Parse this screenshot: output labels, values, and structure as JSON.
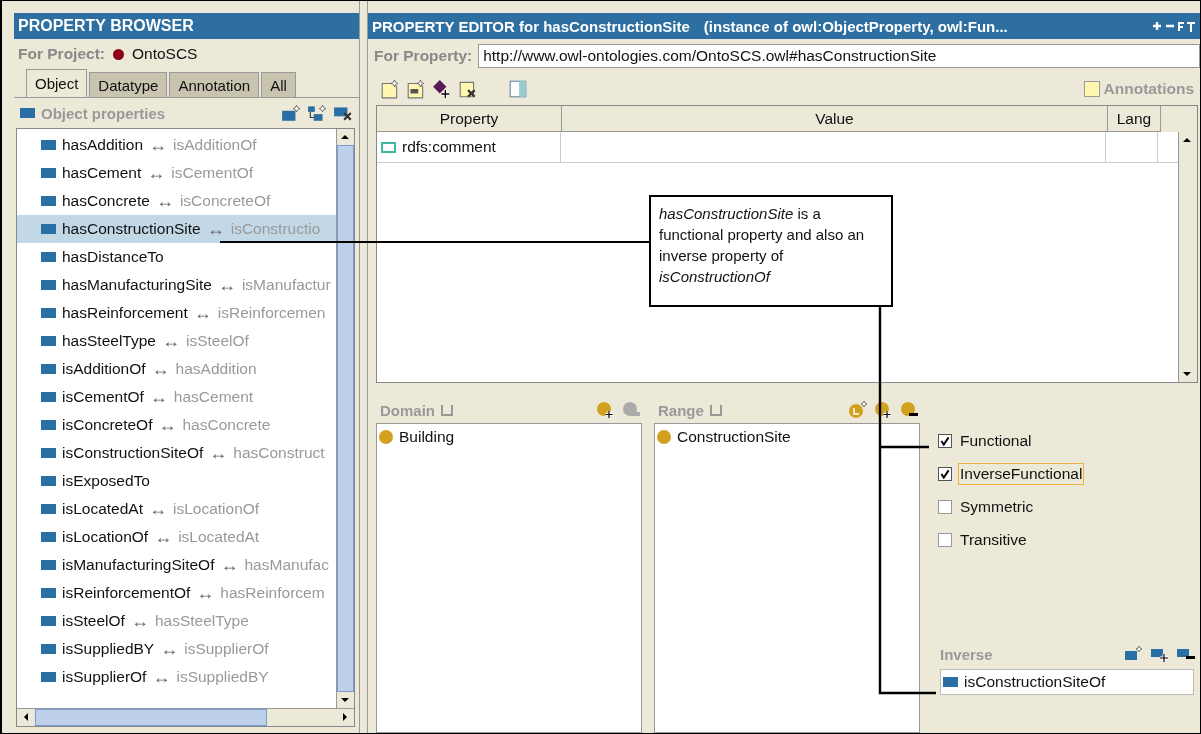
{
  "browser": {
    "title": "PROPERTY BROWSER",
    "project_label": "For Project:",
    "project": "OntoSCS",
    "tabs": [
      {
        "label": "Object",
        "selected": true
      },
      {
        "label": "Datatype",
        "selected": false
      },
      {
        "label": "Annotation",
        "selected": false
      },
      {
        "label": "All",
        "selected": false
      }
    ],
    "section": "Object properties",
    "items": [
      {
        "name": "hasAddition",
        "arrow": "↔",
        "inverse": "isAdditionOf",
        "selected": false
      },
      {
        "name": "hasCement",
        "arrow": "↔",
        "inverse": "isCementOf",
        "selected": false
      },
      {
        "name": "hasConcrete",
        "arrow": "↔",
        "inverse": "isConcreteOf",
        "selected": false
      },
      {
        "name": "hasConstructionSite",
        "arrow": "↔",
        "inverse": "isConstructio",
        "selected": true
      },
      {
        "name": "hasDistanceTo",
        "selected": false
      },
      {
        "name": "hasManufacturingSite",
        "arrow": "↔",
        "inverse": "isManufactur",
        "selected": false
      },
      {
        "name": "hasReinforcement",
        "arrow": "↔",
        "inverse": "isReinforcemen",
        "selected": false
      },
      {
        "name": "hasSteelType",
        "arrow": "↔",
        "inverse": "isSteelOf",
        "selected": false
      },
      {
        "name": "isAdditionOf",
        "arrow": "↔",
        "inverse": "hasAddition",
        "selected": false
      },
      {
        "name": "isCementOf",
        "arrow": "↔",
        "inverse": "hasCement",
        "selected": false
      },
      {
        "name": "isConcreteOf",
        "arrow": "↔",
        "inverse": "hasConcrete",
        "selected": false
      },
      {
        "name": "isConstructionSiteOf",
        "arrow": "↔",
        "inverse": "hasConstruct",
        "selected": false
      },
      {
        "name": "isExposedTo",
        "selected": false
      },
      {
        "name": "isLocatedAt",
        "arrow": "↔",
        "inverse": "isLocationOf",
        "selected": false
      },
      {
        "name": "isLocationOf",
        "arrow": "↔",
        "inverse": "isLocatedAt",
        "selected": false
      },
      {
        "name": "isManufacturingSiteOf",
        "arrow": "↔",
        "inverse": "hasManufac",
        "selected": false
      },
      {
        "name": "isReinforcementOf",
        "arrow": "↔",
        "inverse": "hasReinforcem",
        "selected": false
      },
      {
        "name": "isSteelOf",
        "arrow": "↔",
        "inverse": "hasSteelType",
        "selected": false
      },
      {
        "name": "isSuppliedBY",
        "arrow": "↔",
        "inverse": "isSupplierOf",
        "selected": false
      },
      {
        "name": "isSupplierOf",
        "arrow": "↔",
        "inverse": "isSuppliedBY",
        "selected": false
      }
    ]
  },
  "editor": {
    "title": "PROPERTY EDITOR for hasConstructionSite",
    "subtitle": "(instance of owl:ObjectProperty, owl:Fun...",
    "property_label": "For Property:",
    "property_uri": "http://www.owl-ontologies.com/OntoSCS.owl#hasConstructionSite",
    "annotations_label": "Annotations",
    "table": {
      "columns": [
        "Property",
        "Value",
        "Lang"
      ],
      "rows": [
        {
          "property": "rdfs:comment"
        }
      ]
    },
    "domain": {
      "label": "Domain",
      "items": [
        "Building"
      ]
    },
    "range": {
      "label": "Range",
      "items": [
        "ConstructionSite"
      ]
    },
    "characteristics": [
      {
        "label": "Functional",
        "checked": true,
        "focused": false
      },
      {
        "label": "InverseFunctional",
        "checked": true,
        "focused": true
      },
      {
        "label": "Symmetric",
        "checked": false,
        "focused": false
      },
      {
        "label": "Transitive",
        "checked": false,
        "focused": false
      }
    ],
    "inverse": {
      "label": "Inverse",
      "value": "isConstructionSiteOf"
    }
  },
  "callout": {
    "text": "*hasConstructionSite* is a functional property and also an inverse property of *isConstructionOf*"
  }
}
